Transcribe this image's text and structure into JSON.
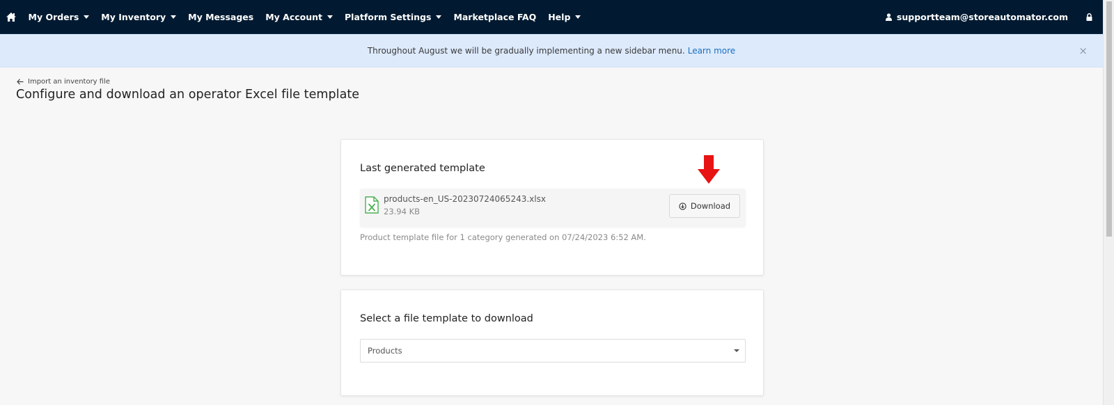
{
  "nav": {
    "home_icon": "home-icon",
    "items": [
      {
        "label": "My Orders",
        "dropdown": true
      },
      {
        "label": "My Inventory",
        "dropdown": true
      },
      {
        "label": "My Messages",
        "dropdown": false
      },
      {
        "label": "My Account",
        "dropdown": true
      },
      {
        "label": "Platform Settings",
        "dropdown": true
      },
      {
        "label": "Marketplace FAQ",
        "dropdown": false
      },
      {
        "label": "Help",
        "dropdown": true
      }
    ],
    "user_email": "supportteam@storeautomator.com",
    "user_icon": "user-icon",
    "lock_icon": "lock-icon",
    "background": "#011a31"
  },
  "banner": {
    "text": "Throughout August we will be gradually implementing a new sidebar menu.",
    "link": "Learn more",
    "close": "×",
    "background": "#ddeafc"
  },
  "header": {
    "back_label": "Import an inventory file",
    "title": "Configure and download an operator Excel file template"
  },
  "last_template": {
    "title": "Last generated template",
    "file_name": "products-en_US-20230724065243.xlsx",
    "file_size": "23.94 KB",
    "download_label": "Download",
    "description": "Product template file for 1 category generated on 07/24/2023 6:52 AM."
  },
  "select_template": {
    "title": "Select a file template to download",
    "selected": "Products"
  },
  "accent": {
    "arrow": "#e81313",
    "excel_green": "#4caf50",
    "link": "#1a6fbf"
  }
}
